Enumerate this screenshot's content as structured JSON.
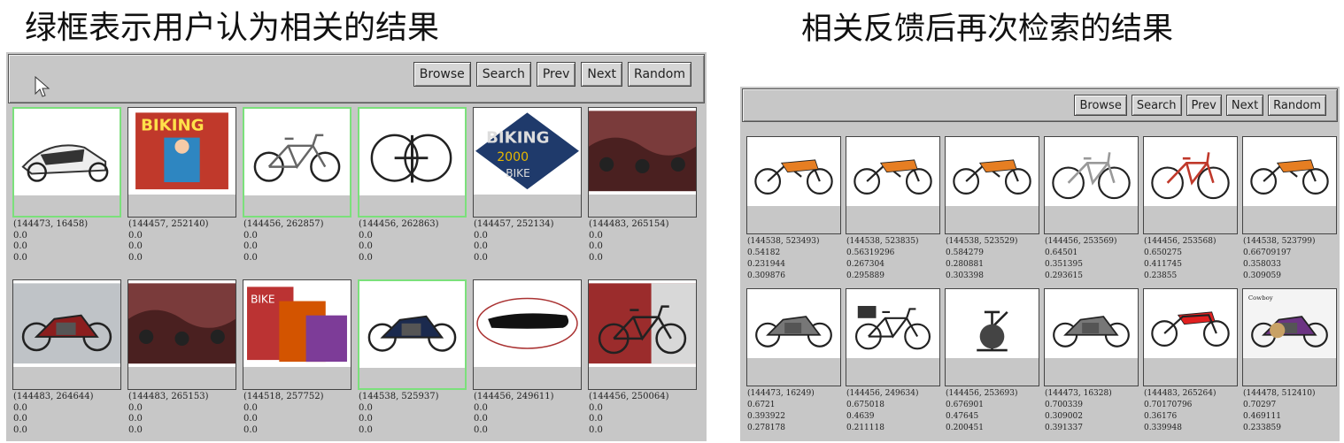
{
  "captions": {
    "left": "绿框表示用户认为相关的结果",
    "right": "相关反馈后再次检索的结果"
  },
  "left_panel": {
    "buttons": [
      "Browse",
      "Search",
      "Prev",
      "Next",
      "Random"
    ],
    "cells": [
      {
        "id": "(144473, 16458)",
        "scores": [
          "0.0",
          "0.0",
          "0.0"
        ],
        "selected": true,
        "icon": "scooter-icon"
      },
      {
        "id": "(144457, 252140)",
        "scores": [
          "0.0",
          "0.0",
          "0.0"
        ],
        "selected": false,
        "icon": "biking-magazine-icon"
      },
      {
        "id": "(144456, 262857)",
        "scores": [
          "0.0",
          "0.0",
          "0.0"
        ],
        "selected": true,
        "icon": "folding-bike-icon"
      },
      {
        "id": "(144456, 262863)",
        "scores": [
          "0.0",
          "0.0",
          "0.0"
        ],
        "selected": true,
        "icon": "folded-bike-icon"
      },
      {
        "id": "(144457, 252134)",
        "scores": [
          "0.0",
          "0.0",
          "0.0"
        ],
        "selected": false,
        "icon": "biking-2000-logo-icon"
      },
      {
        "id": "(144483, 265154)",
        "scores": [
          "0.0",
          "0.0",
          "0.0"
        ],
        "selected": false,
        "icon": "motorcycle-row-icon"
      },
      {
        "id": "(144483, 264644)",
        "scores": [
          "0.0",
          "0.0",
          "0.0"
        ],
        "selected": false,
        "icon": "motorcycle-icon"
      },
      {
        "id": "(144483, 265153)",
        "scores": [
          "0.0",
          "0.0",
          "0.0"
        ],
        "selected": false,
        "icon": "motorcycle-row-icon"
      },
      {
        "id": "(144518, 257752)",
        "scores": [
          "0.0",
          "0.0",
          "0.0"
        ],
        "selected": false,
        "icon": "magazine-stack-icon"
      },
      {
        "id": "(144538, 525937)",
        "scores": [
          "0.0",
          "0.0",
          "0.0"
        ],
        "selected": true,
        "icon": "sport-motorcycle-icon"
      },
      {
        "id": "(144456, 249611)",
        "scores": [
          "0.0",
          "0.0",
          "0.0"
        ],
        "selected": false,
        "icon": "bike-seat-icon"
      },
      {
        "id": "(144456, 250064)",
        "scores": [
          "0.0",
          "0.0",
          "0.0"
        ],
        "selected": false,
        "icon": "hanging-bike-icon"
      }
    ]
  },
  "right_panel": {
    "buttons": [
      "Browse",
      "Search",
      "Prev",
      "Next",
      "Random"
    ],
    "cells": [
      {
        "id": "(144538, 523493)",
        "scores": [
          "0.54182",
          "0.231944",
          "0.309876"
        ],
        "icon": "dirt-bike-icon"
      },
      {
        "id": "(144538, 523835)",
        "scores": [
          "0.56319296",
          "0.267304",
          "0.295889"
        ],
        "icon": "dirt-bike-icon"
      },
      {
        "id": "(144538, 523529)",
        "scores": [
          "0.584279",
          "0.280881",
          "0.303398"
        ],
        "icon": "dirt-bike-icon"
      },
      {
        "id": "(144456, 253569)",
        "scores": [
          "0.64501",
          "0.351395",
          "0.293615"
        ],
        "icon": "bmx-bike-icon"
      },
      {
        "id": "(144456, 253568)",
        "scores": [
          "0.650275",
          "0.411745",
          "0.23855"
        ],
        "icon": "bmx-bike-red-icon"
      },
      {
        "id": "(144538, 523799)",
        "scores": [
          "0.66709197",
          "0.358033",
          "0.309059"
        ],
        "icon": "dirt-bike-icon"
      },
      {
        "id": "(144473, 16249)",
        "scores": [
          "0.6721",
          "0.393922",
          "0.278178"
        ],
        "icon": "vintage-motorcycle-icon"
      },
      {
        "id": "(144456, 249634)",
        "scores": [
          "0.675018",
          "0.4639",
          "0.211118"
        ],
        "icon": "city-bike-icon"
      },
      {
        "id": "(144456, 253693)",
        "scores": [
          "0.676901",
          "0.47645",
          "0.200451"
        ],
        "icon": "exercise-bike-icon"
      },
      {
        "id": "(144473, 16328)",
        "scores": [
          "0.700339",
          "0.309002",
          "0.391337"
        ],
        "icon": "vintage-motorcycle-icon"
      },
      {
        "id": "(144483, 265264)",
        "scores": [
          "0.70170796",
          "0.36176",
          "0.339948"
        ],
        "icon": "red-dirt-bike-icon"
      },
      {
        "id": "(144478, 512410)",
        "scores": [
          "0.70297",
          "0.469111",
          "0.233859"
        ],
        "icon": "motorcycle-ad-icon"
      }
    ]
  },
  "colors": {
    "panel_bg": "#c7c7c7",
    "selected_border": "#7be07b"
  }
}
